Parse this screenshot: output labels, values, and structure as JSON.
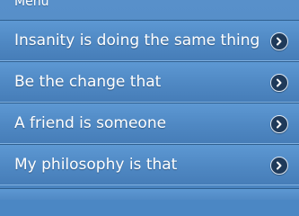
{
  "header": {
    "title": "Menu"
  },
  "menu": {
    "items": [
      {
        "label": "Insanity is doing the same thing",
        "icon": "chevron-right-circle-icon"
      },
      {
        "label": "Be the change that",
        "icon": "chevron-right-circle-icon"
      },
      {
        "label": "A friend is someone",
        "icon": "chevron-right-circle-icon"
      },
      {
        "label": "My philosophy is that",
        "icon": "chevron-right-circle-icon"
      }
    ]
  },
  "colors": {
    "background": "#4b87c4",
    "item_border_dark": "#2f5f8f",
    "item_border_light": "#7fb0e0",
    "chevron_bg": "#1f3a5a",
    "text": "#ffffff"
  }
}
